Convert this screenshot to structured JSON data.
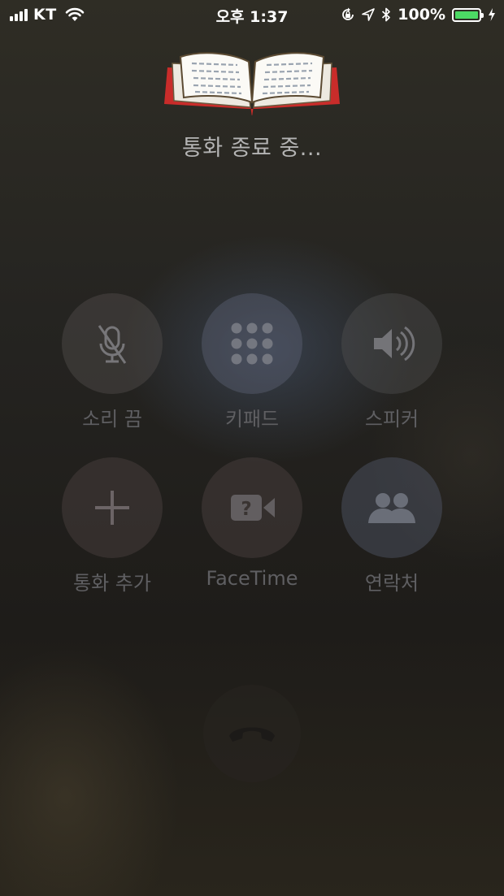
{
  "status_bar": {
    "carrier": "KT",
    "time": "오후 1:37",
    "battery_percent": "100%",
    "battery_color": "#4cd964",
    "icons": [
      "signal-icon",
      "wifi-icon",
      "rotation-lock-icon",
      "location-icon",
      "bluetooth-icon",
      "battery-icon",
      "charging-icon"
    ]
  },
  "call": {
    "status": "통화 종료 중..."
  },
  "controls": [
    {
      "label": "소리 끔",
      "icon": "mute-mic-icon"
    },
    {
      "label": "키패드",
      "icon": "keypad-icon"
    },
    {
      "label": "스피커",
      "icon": "speaker-icon"
    },
    {
      "label": "통화 추가",
      "icon": "add-call-icon"
    },
    {
      "label": "FaceTime",
      "icon": "facetime-icon"
    },
    {
      "label": "연락처",
      "icon": "contacts-icon"
    }
  ],
  "end_call": {
    "icon": "end-call-icon"
  }
}
